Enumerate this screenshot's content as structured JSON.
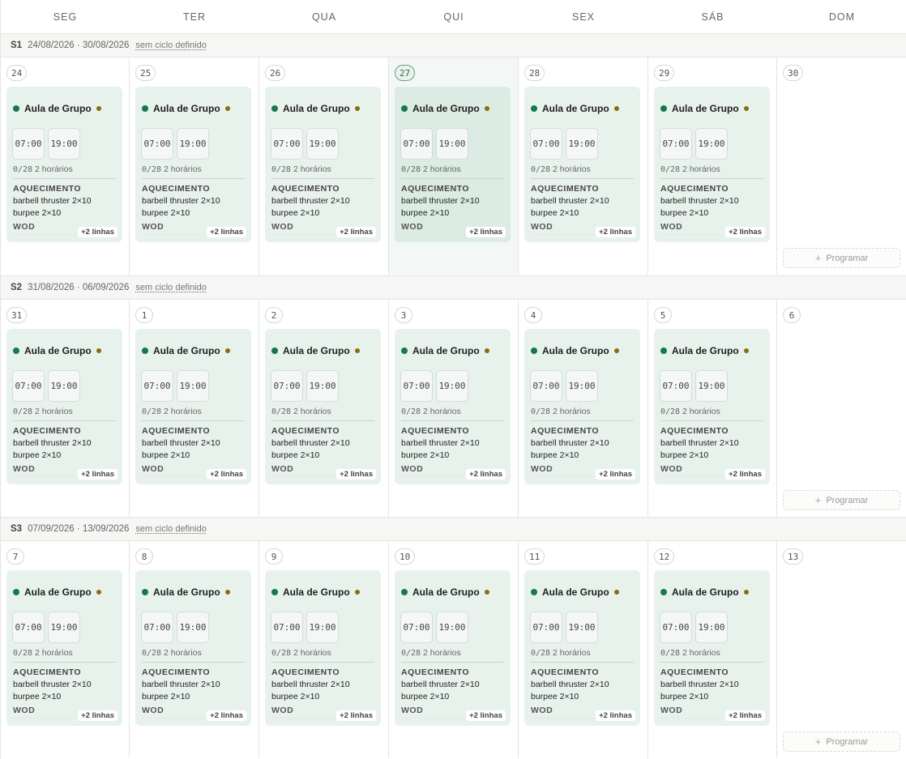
{
  "days": [
    "SEG",
    "TER",
    "QUA",
    "QUI",
    "SEX",
    "SÁB",
    "DOM"
  ],
  "card_template": {
    "title": "Aula de Grupo",
    "times": [
      "07:00",
      "19:00"
    ],
    "booked": "0/28",
    "slots": "2 horários",
    "warmup_label": "AQUECIMENTO",
    "warmup_lines": [
      "barbell thruster 2×10",
      "burpee 2×10"
    ],
    "wod_label": "WOD",
    "more": "+2 linhas"
  },
  "program_label": "Programar",
  "colors": {
    "accent_green": "#17784e",
    "accent_olive": "#8a6d10",
    "card_bg": "#e8f2ed"
  },
  "weeks": [
    {
      "label": "S1",
      "range": "24/08/2026 · 30/08/2026",
      "cycle": "sem ciclo definido",
      "dates": [
        "24",
        "25",
        "26",
        "27",
        "28",
        "29",
        "30"
      ],
      "today_index": 3
    },
    {
      "label": "S2",
      "range": "31/08/2026 · 06/09/2026",
      "cycle": "sem ciclo definido",
      "dates": [
        "31",
        "1",
        "2",
        "3",
        "4",
        "5",
        "6"
      ],
      "today_index": -1
    },
    {
      "label": "S3",
      "range": "07/09/2026 · 13/09/2026",
      "cycle": "sem ciclo definido",
      "dates": [
        "7",
        "8",
        "9",
        "10",
        "11",
        "12",
        "13"
      ],
      "today_index": -1
    }
  ]
}
